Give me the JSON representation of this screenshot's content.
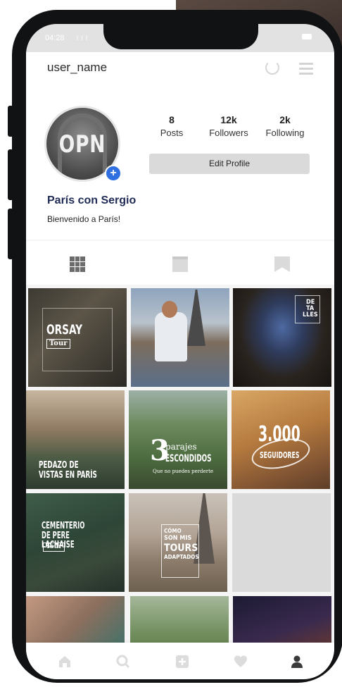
{
  "status_bar": {
    "time": "04:28",
    "signal": "l l l"
  },
  "top_bar": {
    "username": "user_name"
  },
  "profile": {
    "avatar_logo": "OPN",
    "add_badge": "+",
    "name": "París con Sergio",
    "bio": "Bienvenido a París!",
    "stats": [
      {
        "value": "8",
        "label": "Posts"
      },
      {
        "value": "12k",
        "label": "Followers"
      },
      {
        "value": "2k",
        "label": "Following"
      }
    ],
    "edit_button": "Edit Profile"
  },
  "tabs": [
    "grid-tab",
    "feed-tab",
    "tagged-tab"
  ],
  "posts": {
    "orsay": {
      "title": "ORSAY",
      "tag": "Tour"
    },
    "detalles": {
      "line1": "DE",
      "line2": "TA",
      "line3": "LLES"
    },
    "pedazo": {
      "line1": "PEDAZO DE",
      "line2": "VISTAS EN PARÍS"
    },
    "parajes": {
      "num": "3",
      "line1": "parajes",
      "line2": "ESCONDIDOS",
      "sub": "Que no puedes perderte"
    },
    "seguidores": {
      "num": "3.000",
      "label": "SEGUIDORES"
    },
    "cementerio": {
      "line1": "CEMENTERIO",
      "line2": "DE PERE LACHAISE",
      "tag": "Tour"
    },
    "tours": {
      "line1": "CÓMO",
      "line2": "SON MIS",
      "line3": "TOURS",
      "line4": "ADAPTADOS"
    }
  },
  "nav": [
    "home-icon",
    "search-icon",
    "add-post-icon",
    "heart-icon",
    "profile-icon"
  ],
  "colors": {
    "accent_blue": "#2f6fdf",
    "name_navy": "#1f2b55",
    "phone_frame": "#111214"
  }
}
